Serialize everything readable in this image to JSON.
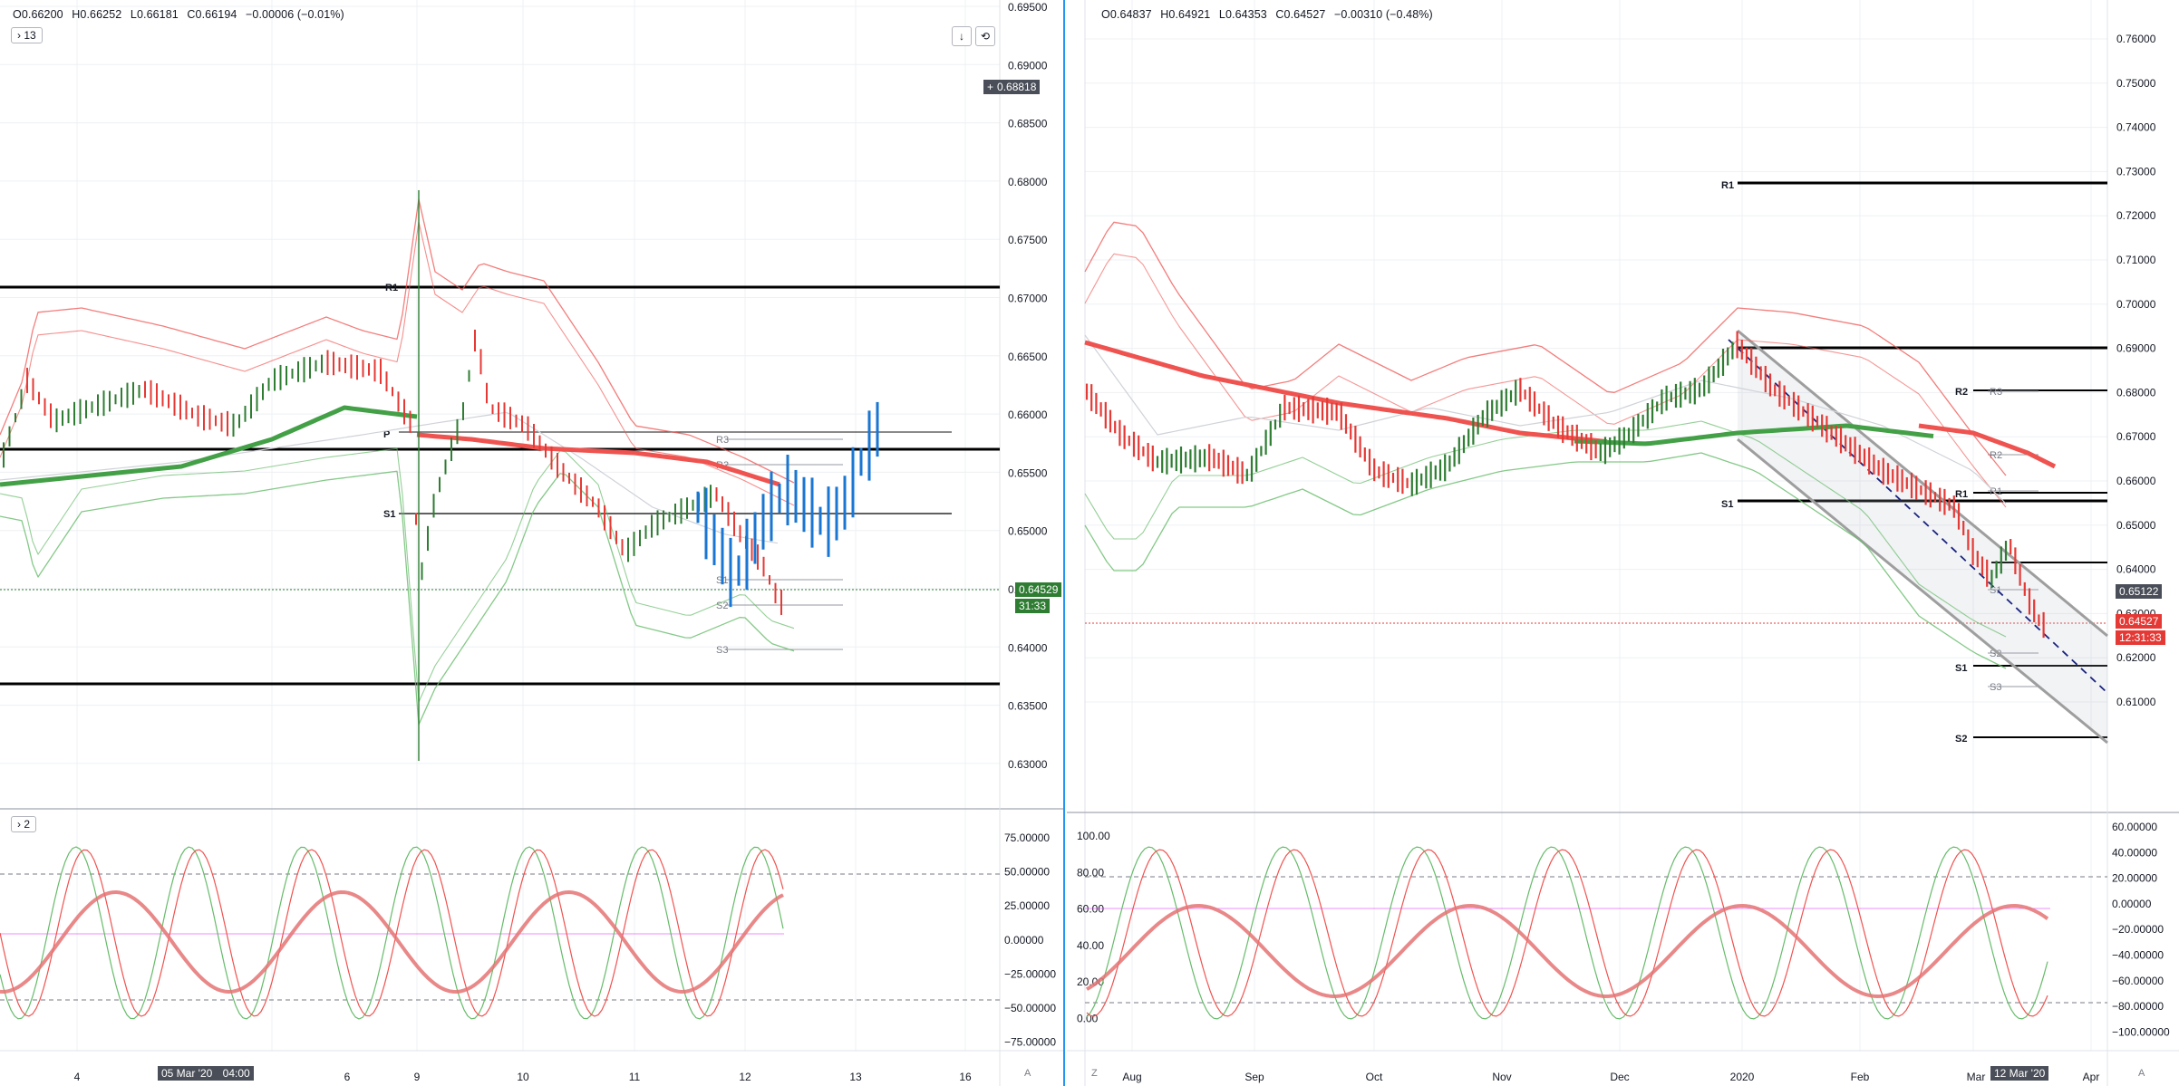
{
  "left": {
    "ohlc": {
      "o": "O0.66200",
      "h": "H0.66252",
      "l": "L0.66181",
      "c": "C0.66194",
      "chg": "−0.00006 (−0.01%)"
    },
    "indicator_toggle": "13",
    "osc_toggle": "2",
    "price_ticks": [
      "0.69500",
      "0.69000",
      "0.68500",
      "0.68000",
      "0.67500",
      "0.67000",
      "0.66500",
      "0.66000",
      "0.65500",
      "0.65000",
      "0.64500",
      "0.64000",
      "0.63500",
      "0.63000"
    ],
    "osc_ticks": [
      "75.00000",
      "50.00000",
      "25.00000",
      "0.00000",
      "−25.00000",
      "−50.00000",
      "−75.00000"
    ],
    "time_ticks": [
      "4",
      "6",
      "9",
      "10",
      "11",
      "12",
      "13",
      "16"
    ],
    "cursor_date": "05 Mar '20",
    "cursor_time": "04:00",
    "crosshair_price": "0.68818",
    "last_price": "0.64529",
    "countdown": "31:33",
    "pivots": {
      "r1": "R1",
      "p": "P",
      "s1": "S1",
      "r3": "R3",
      "r2": "R2",
      "s1b": "S1",
      "s2": "S2",
      "s3": "S3"
    },
    "axis_mode": "A"
  },
  "right": {
    "ohlc": {
      "o": "O0.64837",
      "h": "H0.64921",
      "l": "L0.64353",
      "c": "C0.64527",
      "chg": "−0.00310 (−0.48%)"
    },
    "price_ticks": [
      "0.76000",
      "0.75000",
      "0.74000",
      "0.73000",
      "0.72000",
      "0.71000",
      "0.70000",
      "0.69000",
      "0.68000",
      "0.67000",
      "0.66000",
      "0.65000",
      "0.64000",
      "0.63000",
      "0.62000",
      "0.61000"
    ],
    "osc_left_ticks": [
      "100.00",
      "80.00",
      "60.00",
      "40.00",
      "20.00",
      "0.00"
    ],
    "osc_right_ticks": [
      "60.00000",
      "40.00000",
      "20.00000",
      "0.00000",
      "−20.00000",
      "−40.00000",
      "−60.00000",
      "−80.00000",
      "−100.00000"
    ],
    "time_ticks": [
      "Aug",
      "Sep",
      "Oct",
      "Nov",
      "Dec",
      "2020",
      "Feb",
      "Mar",
      "Apr"
    ],
    "cursor_date": "12 Mar '20",
    "crosshair_price": "0.65122",
    "last_price": "0.64527",
    "countdown": "12:31:33",
    "pivots": {
      "r1": "R1",
      "r2": "R2",
      "r1b": "R1",
      "s1": "S1",
      "s1b": "S1",
      "s2": "S2",
      "r3g": "R3",
      "r2g": "R2",
      "r1g": "R1",
      "s1g": "S1",
      "s2g": "S2",
      "s3g": "S3"
    },
    "axis_mode": "A",
    "zoom_mode": "Z"
  }
}
